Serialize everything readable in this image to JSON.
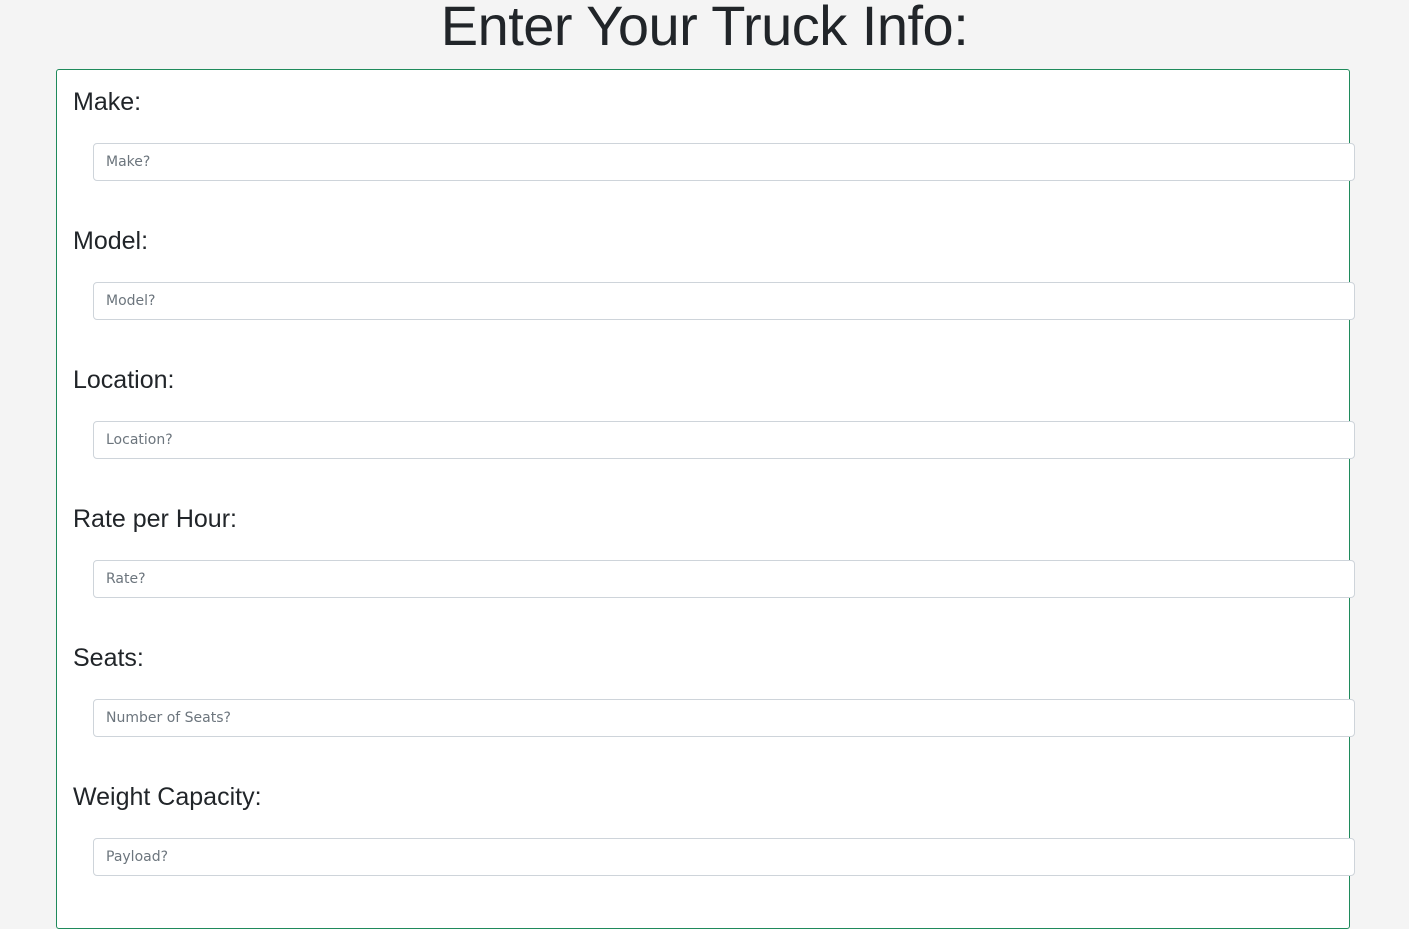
{
  "page": {
    "title": "Enter Your Truck Info:"
  },
  "colors": {
    "background": "#f4f4f4",
    "card_border": "#1f8a5b",
    "text": "#212529",
    "input_border": "#ced4da",
    "placeholder": "#6c757d"
  },
  "form": {
    "fields": [
      {
        "label": "Make:",
        "placeholder": "Make?",
        "value": ""
      },
      {
        "label": "Model:",
        "placeholder": "Model?",
        "value": ""
      },
      {
        "label": "Location:",
        "placeholder": "Location?",
        "value": ""
      },
      {
        "label": "Rate per Hour:",
        "placeholder": "Rate?",
        "value": ""
      },
      {
        "label": "Seats:",
        "placeholder": "Number of Seats?",
        "value": ""
      },
      {
        "label": "Weight Capacity:",
        "placeholder": "Payload?",
        "value": ""
      }
    ]
  }
}
